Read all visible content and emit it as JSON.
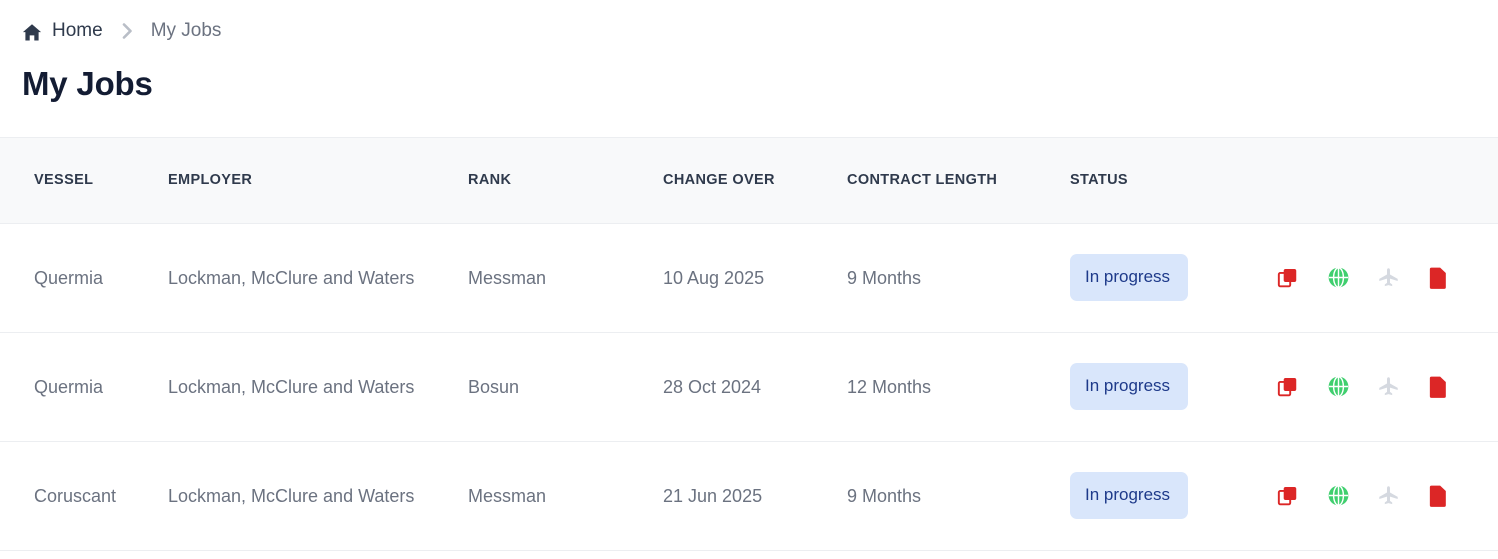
{
  "breadcrumb": {
    "home_icon": "home-icon",
    "home_label": "Home",
    "separator": "›",
    "current_label": "My Jobs"
  },
  "page": {
    "title": "My Jobs"
  },
  "colors": {
    "title_text": "#131c33",
    "muted_text": "#6b7280",
    "header_bg": "#f8f9fa",
    "row_border": "#eceef1",
    "badge_bg": "#d9e6fb",
    "badge_text": "#1e3a8a",
    "icon_red": "#dc2626",
    "icon_green": "#3fcf6e",
    "icon_gray": "#d5d9e0"
  },
  "table": {
    "columns": [
      {
        "key": "vessel",
        "label": "Vessel"
      },
      {
        "key": "employer",
        "label": "Employer"
      },
      {
        "key": "rank",
        "label": "Rank"
      },
      {
        "key": "change_over",
        "label": "Change over"
      },
      {
        "key": "contract_length",
        "label": "Contract length"
      },
      {
        "key": "status",
        "label": "Status"
      },
      {
        "key": "actions",
        "label": ""
      }
    ],
    "headers": {
      "vessel": "VESSEL",
      "employer": "EMPLOYER",
      "rank": "RANK",
      "change_over": "CHANGE OVER",
      "contract_length": "CONTRACT LENGTH",
      "status": "STATUS"
    },
    "rows": [
      {
        "vessel": "Quermia",
        "employer": "Lockman, McClure and Waters",
        "rank": "Messman",
        "change_over": "10 Aug 2025",
        "contract_length": "9 Months",
        "status": "In progress",
        "actions": [
          "copy-icon",
          "globe-icon",
          "airplane-icon",
          "document-icon"
        ]
      },
      {
        "vessel": "Quermia",
        "employer": "Lockman, McClure and Waters",
        "rank": "Bosun",
        "change_over": "28 Oct 2024",
        "contract_length": "12 Months",
        "status": "In progress",
        "actions": [
          "copy-icon",
          "globe-icon",
          "airplane-icon",
          "document-icon"
        ]
      },
      {
        "vessel": "Coruscant",
        "employer": "Lockman, McClure and Waters",
        "rank": "Messman",
        "change_over": "21 Jun 2025",
        "contract_length": "9 Months",
        "status": "In progress",
        "actions": [
          "copy-icon",
          "globe-icon",
          "airplane-icon",
          "document-icon"
        ]
      }
    ]
  }
}
